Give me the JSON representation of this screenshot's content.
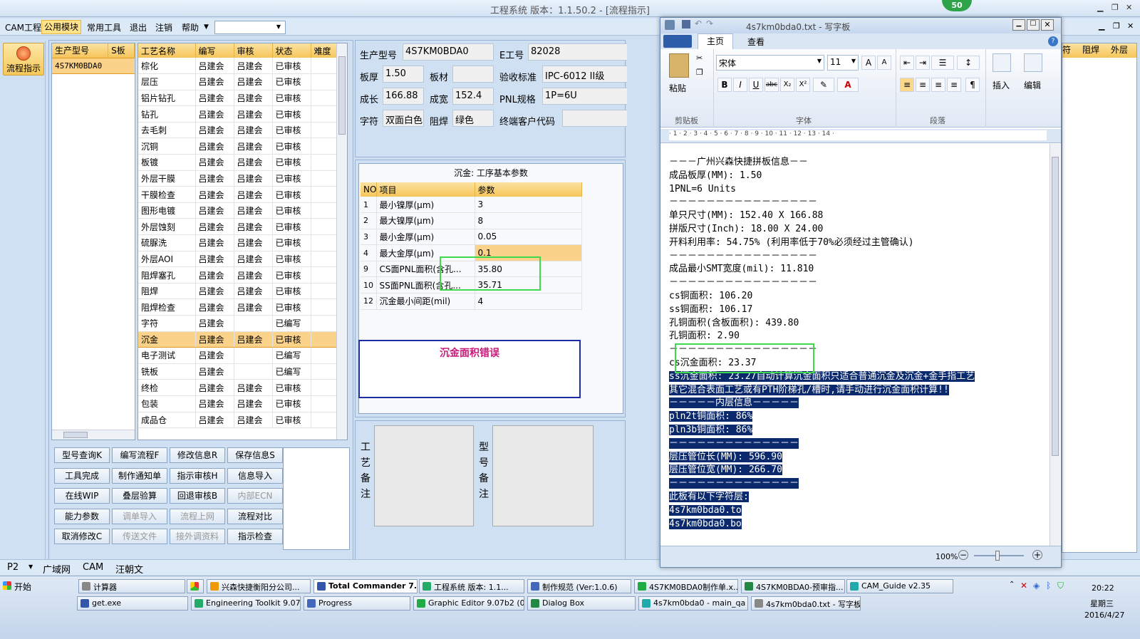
{
  "app": {
    "title": "工程系统   版本：1.1.50.2 - [流程指示]",
    "badge": "50"
  },
  "menu": {
    "items": [
      "CAM工程",
      "公用模块",
      "常用工具",
      "退出",
      "注销",
      "帮助"
    ],
    "active": "公用模块"
  },
  "left": {
    "flow_button": "流程指示"
  },
  "model_list": {
    "headers": [
      "生产型号",
      "S板"
    ],
    "rows": [
      [
        "4S7KM0BDA0",
        ""
      ]
    ]
  },
  "process": {
    "headers": [
      "工艺名称",
      "编写",
      "审核",
      "状态",
      "难度"
    ],
    "rows": [
      [
        "棕化",
        "吕建会",
        "吕建会",
        "已审核"
      ],
      [
        "层压",
        "吕建会",
        "吕建会",
        "已审核"
      ],
      [
        "铝片钻孔",
        "吕建会",
        "吕建会",
        "已审核"
      ],
      [
        "钻孔",
        "吕建会",
        "吕建会",
        "已审核"
      ],
      [
        "去毛刺",
        "吕建会",
        "吕建会",
        "已审核"
      ],
      [
        "沉铜",
        "吕建会",
        "吕建会",
        "已审核"
      ],
      [
        "板镀",
        "吕建会",
        "吕建会",
        "已审核"
      ],
      [
        "外层干膜",
        "吕建会",
        "吕建会",
        "已审核"
      ],
      [
        "干膜检查",
        "吕建会",
        "吕建会",
        "已审核"
      ],
      [
        "图形电镀",
        "吕建会",
        "吕建会",
        "已审核"
      ],
      [
        "外层蚀刻",
        "吕建会",
        "吕建会",
        "已审核"
      ],
      [
        "硫脲洗",
        "吕建会",
        "吕建会",
        "已审核"
      ],
      [
        "外层AOI",
        "吕建会",
        "吕建会",
        "已审核"
      ],
      [
        "阻焊塞孔",
        "吕建会",
        "吕建会",
        "已审核"
      ],
      [
        "阻焊",
        "吕建会",
        "吕建会",
        "已审核"
      ],
      [
        "阻焊检查",
        "吕建会",
        "吕建会",
        "已审核"
      ],
      [
        "字符",
        "吕建会",
        "",
        "已编写"
      ],
      [
        "沉金",
        "吕建会",
        "吕建会",
        "已审核"
      ],
      [
        "电子测试",
        "吕建会",
        "",
        "已编写"
      ],
      [
        "铣板",
        "吕建会",
        "",
        "已编写"
      ],
      [
        "终检",
        "吕建会",
        "吕建会",
        "已审核"
      ],
      [
        "包装",
        "吕建会",
        "吕建会",
        "已审核"
      ],
      [
        "成品仓",
        "吕建会",
        "吕建会",
        "已审核"
      ]
    ],
    "selected_index": 17
  },
  "buttons": [
    [
      "型号查询K",
      "编写流程F",
      "修改信息R",
      "保存信息S"
    ],
    [
      "工具完成",
      "制作通知单",
      "指示审核H",
      "信息导入"
    ],
    [
      "在线WIP",
      "叠层验算",
      "回退审核B",
      "内部ECN"
    ],
    [
      "能力参数",
      "调单导入",
      "流程上网",
      "流程对比"
    ],
    [
      "取消修改C",
      "传送文件",
      "接外调资料",
      "指示检查"
    ]
  ],
  "disabled_buttons": [
    "内部ECN",
    "调单导入",
    "流程上网",
    "传送文件",
    "接外调资料"
  ],
  "info": {
    "model_label": "生产型号",
    "model": "4S7KM0BDA0",
    "eno_label": "E工号",
    "eno": "82028",
    "thick_label": "板厚",
    "thick": "1.50",
    "mat_label": "板材",
    "mat": "",
    "std_label": "验收标准",
    "std": "IPC-6012 II级",
    "len_label": "成长",
    "len": "166.88",
    "wid_label": "成宽",
    "wid": "152.4",
    "pnl_label": "PNL规格",
    "pnl": "1P=6U",
    "char_label": "字符",
    "char": "双面白色",
    "mask_label": "阻焊",
    "mask": "绿色",
    "cust_label": "终端客户代码",
    "cust": ""
  },
  "params": {
    "title": "沉金: 工序基本参数",
    "headers": [
      "NO",
      "项目",
      "参数"
    ],
    "rows": [
      [
        "1",
        "最小镍厚(μm)",
        "3"
      ],
      [
        "2",
        "最大镍厚(μm)",
        "8"
      ],
      [
        "3",
        "最小金厚(μm)",
        "0.05"
      ],
      [
        "4",
        "最大金厚(μm)",
        "0.1"
      ],
      [
        "9",
        "CS面PNL面积(含孔...",
        "35.80"
      ],
      [
        "10",
        "SS面PNL面积(含孔...",
        "35.71"
      ],
      [
        "12",
        "沉金最小间距(mil)",
        "4"
      ]
    ],
    "note": "沉金面积错误"
  },
  "remarks": {
    "process": "工艺备注",
    "model": "型号备注"
  },
  "right_headers": [
    "符",
    "阻焊",
    "外层"
  ],
  "status": {
    "item0": "P2",
    "item1": "广域网",
    "item2": "CAM",
    "item3": "汪朝文"
  },
  "wordpad": {
    "title": "4s7km0bda0.txt - 写字板",
    "tabs": [
      "主页",
      "查看"
    ],
    "font": "宋体",
    "size": "11",
    "groups": [
      "剪贴板",
      "字体",
      "段落"
    ],
    "paste": "粘贴",
    "insert": "插入",
    "edit": "编辑",
    "zoom": "100%",
    "ruler": "· 1 · 2 · 3 · 4 · 5 · 6 · 7 · 8 · 9 · 10 · 11 · 12 · 13 · 14 ·",
    "lines": [
      "－－－广州兴森快捷拼板信息－－",
      "成品板厚(MM): 1.50",
      "1PNL=6 Units",
      "－－－－－－－－－－－－－－－－",
      "单只尺寸(MM): 152.40 X 166.88",
      "拼版尺寸(Inch): 18.00 X 24.00",
      "开料利用率: 54.75% (利用率低于70%必须经过主管确认)",
      "－－－－－－－－－－－－－－－－",
      "成品最小SMT宽度(mil): 11.810",
      "－－－－－－－－－－－－－－－－",
      "cs铜面积: 106.20",
      "ss铜面积: 106.17",
      "孔铜面积(含板面积): 439.80",
      "孔铜面积: 2.90",
      "－－－－－－－－－－－－－－－－",
      "cs沉金面积: 23.37",
      "ss沉金面积: 23.27自动计算沉金面积只适合普通沉金及沉金+金手指工艺",
      "其它混合表面工艺或有PTH阶梯孔/槽时,请手动进行沉金面积计算!!",
      "－－－－－内层信息－－－－－",
      "pln2t铜面积: 86%",
      "pln3b铜面积: 86%",
      "－－－－－－－－－－－－－－",
      "层压管位长(MM): 596.90",
      "层压管位宽(MM): 266.70",
      "－－－－－－－－－－－－－－",
      "此板有以下字符层:",
      "4s7km0bda0.to",
      "4s7km0bda0.bo"
    ],
    "highlight_from": 16
  },
  "taskbar": {
    "start": "开始",
    "row1": [
      "计算器",
      "兴森快捷衡阳分公司...",
      "Total Commander 7...",
      "工程系统  版本: 1.1...",
      "制作规范 (Ver:1.0.6)",
      "4S7KM0BDA0制作单.x...",
      "4S7KM0BDA0-预审指...",
      "CAM_Guide v2.35"
    ],
    "row2": [
      "get.exe",
      "Engineering Toolkit 9.07...",
      "Progress",
      "Graphic Editor 9.07b2 (0...",
      "Dialog Box",
      "4s7km0bda0 - main_qa",
      "4s7km0bda0.txt - 写字板"
    ],
    "active": "Total Commander 7...",
    "time": "20:22",
    "weekday": "星期三",
    "date": "2016/4/27"
  }
}
